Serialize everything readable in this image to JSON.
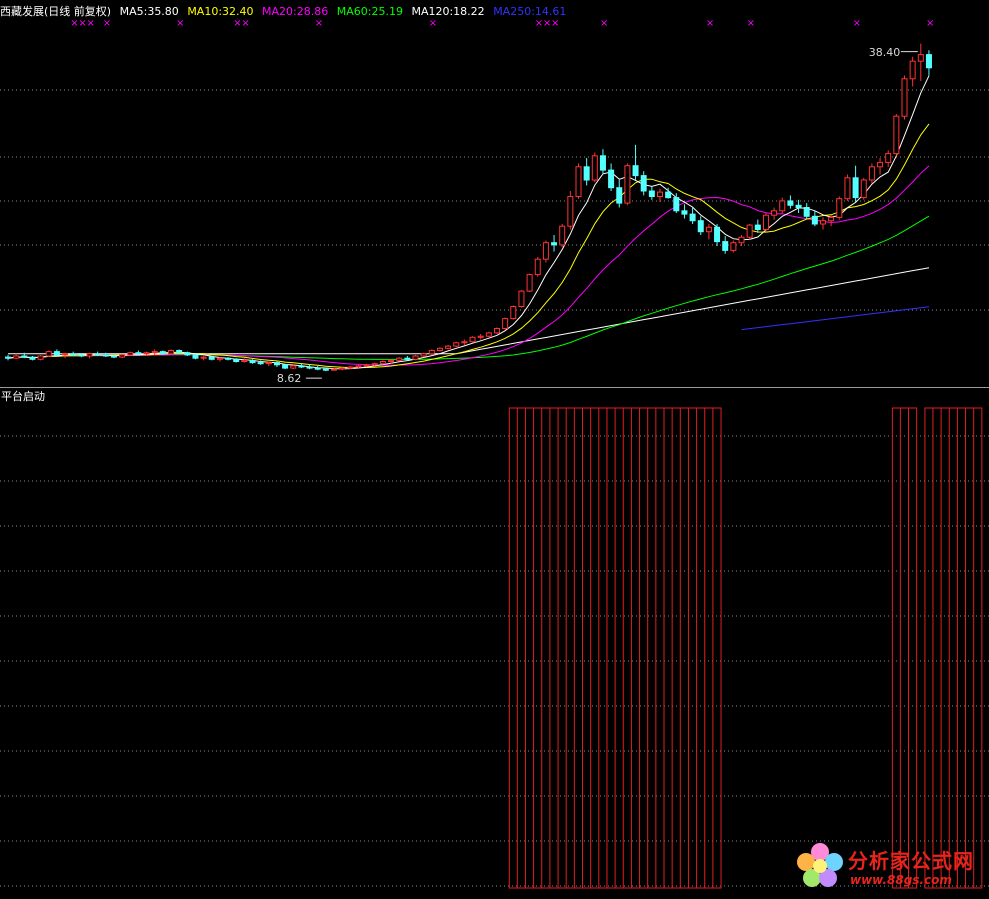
{
  "legend": {
    "title": "西藏发展(日线 前复权)",
    "ma5": "MA5:35.80",
    "ma10": "MA10:32.40",
    "ma20": "MA20:28.86",
    "ma60": "MA60:25.19",
    "ma120": "MA120:18.22",
    "ma250": "MA250:14.61"
  },
  "colors": {
    "bg": "#000000",
    "up": "#ff3232",
    "down": "#54ffff",
    "ma5": "#ffffff",
    "ma10": "#ffff00",
    "ma20": "#ff00ff",
    "ma60": "#00ff00",
    "ma120": "#ffffff",
    "ma250": "#3232ff",
    "grid": "#8a8a8a",
    "indicator": "#e02020",
    "marker": "#ff00ff"
  },
  "annotations": {
    "high": "38.40",
    "low": "8.62"
  },
  "indicator": {
    "title": "平台启动"
  },
  "watermark": {
    "title": "分析家公式网",
    "url": "www.88gs.com"
  },
  "chart_data": {
    "type": "candlestick",
    "candles": [
      [
        9.9,
        10.1,
        9.6,
        9.8
      ],
      [
        9.8,
        10.2,
        9.7,
        10.0
      ],
      [
        10.0,
        10.3,
        9.8,
        9.9
      ],
      [
        9.9,
        10.0,
        9.6,
        9.7
      ],
      [
        9.7,
        10.1,
        9.6,
        10.0
      ],
      [
        10.0,
        10.5,
        9.9,
        10.4
      ],
      [
        10.4,
        10.6,
        10.0,
        10.1
      ],
      [
        10.1,
        10.3,
        9.8,
        10.2
      ],
      [
        10.2,
        10.4,
        10.0,
        10.1
      ],
      [
        10.1,
        10.2,
        9.9,
        10.0
      ],
      [
        10.0,
        10.3,
        9.8,
        10.2
      ],
      [
        10.2,
        10.4,
        10.0,
        10.1
      ],
      [
        10.1,
        10.3,
        9.9,
        10.0
      ],
      [
        10.0,
        10.1,
        9.8,
        9.9
      ],
      [
        9.9,
        10.2,
        9.8,
        10.1
      ],
      [
        10.1,
        10.4,
        10.0,
        10.3
      ],
      [
        10.3,
        10.5,
        10.1,
        10.2
      ],
      [
        10.2,
        10.4,
        10.0,
        10.3
      ],
      [
        10.3,
        10.6,
        10.1,
        10.4
      ],
      [
        10.4,
        10.5,
        10.1,
        10.2
      ],
      [
        10.2,
        10.6,
        10.1,
        10.5
      ],
      [
        10.5,
        10.6,
        10.2,
        10.3
      ],
      [
        10.3,
        10.4,
        10.0,
        10.1
      ],
      [
        10.1,
        10.2,
        9.7,
        9.8
      ],
      [
        9.8,
        10.0,
        9.6,
        9.9
      ],
      [
        9.9,
        10.0,
        9.6,
        9.7
      ],
      [
        9.7,
        9.9,
        9.5,
        9.8
      ],
      [
        9.8,
        9.9,
        9.6,
        9.7
      ],
      [
        9.7,
        9.8,
        9.4,
        9.5
      ],
      [
        9.5,
        9.8,
        9.4,
        9.6
      ],
      [
        9.6,
        9.7,
        9.3,
        9.4
      ],
      [
        9.4,
        9.6,
        9.2,
        9.3
      ],
      [
        9.3,
        9.5,
        9.1,
        9.4
      ],
      [
        9.4,
        9.5,
        9.0,
        9.2
      ],
      [
        9.2,
        9.3,
        8.8,
        8.9
      ],
      [
        8.9,
        9.2,
        8.8,
        9.1
      ],
      [
        9.1,
        9.3,
        8.9,
        9.0
      ],
      [
        9.0,
        9.2,
        8.8,
        8.9
      ],
      [
        8.9,
        9.1,
        8.7,
        8.8
      ],
      [
        8.8,
        8.95,
        8.62,
        8.75
      ],
      [
        8.75,
        8.9,
        8.7,
        8.8
      ],
      [
        8.8,
        9.0,
        8.7,
        8.9
      ],
      [
        8.9,
        9.1,
        8.8,
        9.0
      ],
      [
        9.0,
        9.2,
        8.9,
        9.1
      ],
      [
        9.1,
        9.3,
        9.0,
        9.2
      ],
      [
        9.2,
        9.4,
        9.1,
        9.3
      ],
      [
        9.3,
        9.6,
        9.2,
        9.5
      ],
      [
        9.5,
        9.7,
        9.3,
        9.6
      ],
      [
        9.6,
        9.9,
        9.5,
        9.8
      ],
      [
        9.8,
        10.0,
        9.6,
        9.7
      ],
      [
        9.7,
        10.1,
        9.6,
        10.0
      ],
      [
        10.0,
        10.3,
        9.9,
        10.2
      ],
      [
        10.2,
        10.6,
        10.1,
        10.5
      ],
      [
        10.5,
        10.8,
        10.4,
        10.7
      ],
      [
        10.7,
        11.0,
        10.6,
        10.9
      ],
      [
        10.9,
        11.3,
        10.8,
        11.2
      ],
      [
        11.2,
        11.5,
        11.0,
        11.3
      ],
      [
        11.3,
        11.8,
        11.2,
        11.7
      ],
      [
        11.7,
        12.0,
        11.5,
        11.8
      ],
      [
        11.8,
        12.2,
        11.7,
        12.1
      ],
      [
        12.1,
        12.6,
        12.0,
        12.5
      ],
      [
        12.5,
        13.5,
        12.4,
        13.4
      ],
      [
        13.4,
        14.6,
        13.3,
        14.5
      ],
      [
        14.5,
        16.0,
        14.4,
        15.9
      ],
      [
        15.9,
        17.5,
        15.8,
        17.4
      ],
      [
        17.4,
        19.0,
        17.2,
        18.8
      ],
      [
        18.8,
        20.5,
        18.5,
        20.3
      ],
      [
        20.3,
        21.0,
        19.5,
        20.1
      ],
      [
        20.1,
        22.0,
        19.9,
        21.8
      ],
      [
        21.8,
        25.0,
        21.5,
        24.5
      ],
      [
        24.5,
        27.5,
        24.3,
        27.2
      ],
      [
        27.2,
        28.0,
        25.5,
        26.0
      ],
      [
        26.0,
        28.5,
        25.8,
        28.2
      ],
      [
        28.2,
        28.8,
        26.5,
        26.9
      ],
      [
        26.9,
        27.5,
        25.0,
        25.3
      ],
      [
        25.3,
        26.0,
        23.5,
        23.9
      ],
      [
        23.9,
        27.5,
        23.7,
        27.3
      ],
      [
        27.3,
        29.2,
        26.0,
        26.4
      ],
      [
        26.4,
        26.8,
        24.6,
        25.0
      ],
      [
        25.0,
        25.4,
        24.2,
        24.5
      ],
      [
        24.5,
        25.2,
        24.0,
        24.9
      ],
      [
        24.9,
        25.3,
        24.3,
        24.4
      ],
      [
        24.4,
        24.8,
        23.0,
        23.2
      ],
      [
        23.2,
        23.8,
        22.5,
        22.9
      ],
      [
        22.9,
        23.5,
        22.0,
        22.3
      ],
      [
        22.3,
        22.7,
        21.0,
        21.3
      ],
      [
        21.3,
        22.0,
        20.6,
        21.7
      ],
      [
        21.7,
        22.0,
        20.0,
        20.4
      ],
      [
        20.4,
        20.9,
        19.3,
        19.6
      ],
      [
        19.6,
        20.5,
        19.4,
        20.3
      ],
      [
        20.3,
        21.0,
        20.0,
        20.8
      ],
      [
        20.8,
        22.0,
        20.6,
        21.9
      ],
      [
        21.9,
        22.4,
        21.2,
        21.5
      ],
      [
        21.5,
        23.0,
        21.3,
        22.8
      ],
      [
        22.8,
        23.5,
        22.4,
        23.2
      ],
      [
        23.2,
        24.4,
        23.0,
        24.1
      ],
      [
        24.1,
        24.6,
        23.4,
        23.7
      ],
      [
        23.7,
        24.2,
        23.0,
        23.5
      ],
      [
        23.5,
        23.9,
        22.5,
        22.7
      ],
      [
        22.7,
        23.2,
        21.8,
        22.0
      ],
      [
        22.0,
        22.6,
        21.5,
        22.3
      ],
      [
        22.3,
        22.8,
        21.8,
        22.6
      ],
      [
        22.6,
        24.5,
        22.4,
        24.3
      ],
      [
        24.3,
        26.5,
        24.1,
        26.2
      ],
      [
        26.2,
        27.3,
        24.0,
        24.4
      ],
      [
        24.4,
        26.2,
        24.2,
        26.0
      ],
      [
        26.0,
        27.5,
        25.7,
        27.2
      ],
      [
        27.2,
        28.0,
        26.5,
        27.6
      ],
      [
        27.6,
        28.7,
        27.2,
        28.4
      ],
      [
        28.4,
        32.0,
        28.2,
        31.8
      ],
      [
        31.8,
        35.5,
        31.5,
        35.2
      ],
      [
        35.2,
        37.2,
        34.5,
        36.8
      ],
      [
        36.8,
        38.4,
        35.0,
        37.4
      ],
      [
        37.4,
        37.8,
        35.5,
        36.2
      ]
    ],
    "ylim": [
      8.0,
      40.0
    ],
    "indicator_bars": {
      "name": "平台启动",
      "active_ranges": [
        [
          62,
          87
        ],
        [
          109,
          111
        ],
        [
          113,
          119
        ]
      ]
    }
  }
}
